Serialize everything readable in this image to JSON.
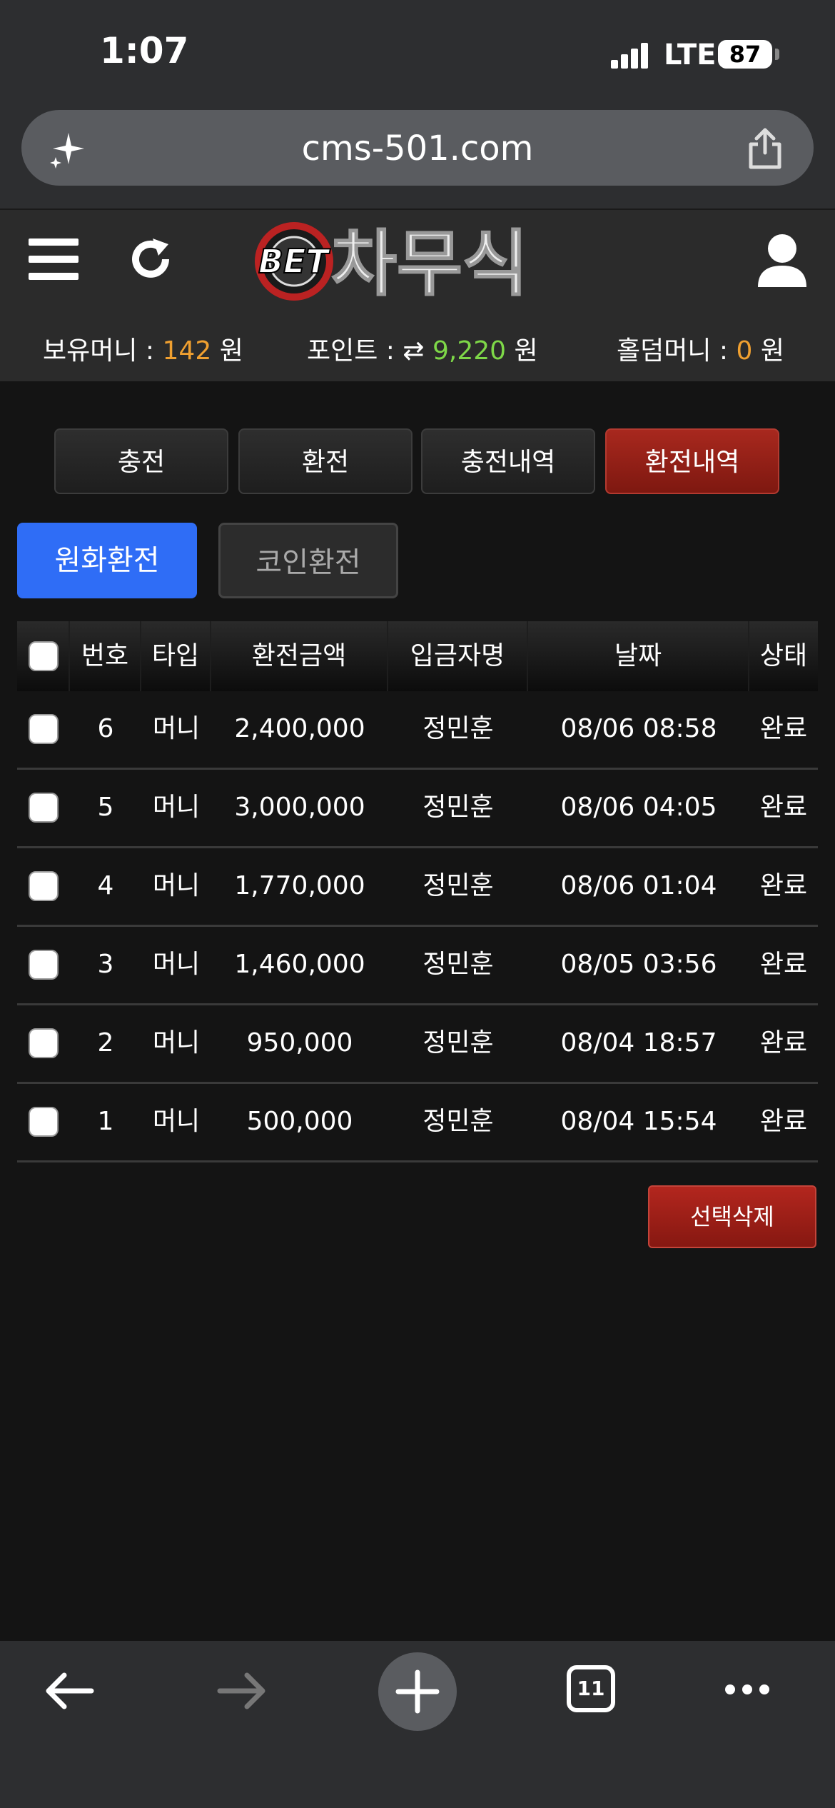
{
  "status_bar": {
    "time": "1:07",
    "network": "LTE",
    "battery": "87"
  },
  "browser": {
    "url": "cms-501.com",
    "tab_count": "11"
  },
  "header": {
    "logo_text": "BET 차무식",
    "balance_label": "보유머니 :",
    "balance_value": "142",
    "balance_unit": "원",
    "point_label": "포인트 :",
    "point_value": "9,220",
    "point_unit": "원",
    "holdem_label": "홀덤머니 :",
    "holdem_value": "0",
    "holdem_unit": "원"
  },
  "tabs": [
    {
      "label": "충전"
    },
    {
      "label": "환전"
    },
    {
      "label": "충전내역"
    },
    {
      "label": "환전내역",
      "active": true
    }
  ],
  "subtabs": [
    {
      "label": "원화환전",
      "active": true
    },
    {
      "label": "코인환전"
    }
  ],
  "table": {
    "headers": [
      "번호",
      "타입",
      "환전금액",
      "입금자명",
      "날짜",
      "상태"
    ],
    "rows": [
      {
        "no": "6",
        "type": "머니",
        "amount": "2,400,000",
        "name": "정민훈",
        "date": "08/06 08:58",
        "status": "완료"
      },
      {
        "no": "5",
        "type": "머니",
        "amount": "3,000,000",
        "name": "정민훈",
        "date": "08/06 04:05",
        "status": "완료"
      },
      {
        "no": "4",
        "type": "머니",
        "amount": "1,770,000",
        "name": "정민훈",
        "date": "08/06 01:04",
        "status": "완료"
      },
      {
        "no": "3",
        "type": "머니",
        "amount": "1,460,000",
        "name": "정민훈",
        "date": "08/05 03:56",
        "status": "완료"
      },
      {
        "no": "2",
        "type": "머니",
        "amount": "950,000",
        "name": "정민훈",
        "date": "08/04 18:57",
        "status": "완료"
      },
      {
        "no": "1",
        "type": "머니",
        "amount": "500,000",
        "name": "정민훈",
        "date": "08/04 15:54",
        "status": "완료"
      }
    ]
  },
  "delete_button": "선택삭제",
  "colors": {
    "active_tab": "#a8281e",
    "subtab_active": "#2f6df6",
    "money_orange": "#f0a030",
    "point_green": "#7ed848"
  }
}
